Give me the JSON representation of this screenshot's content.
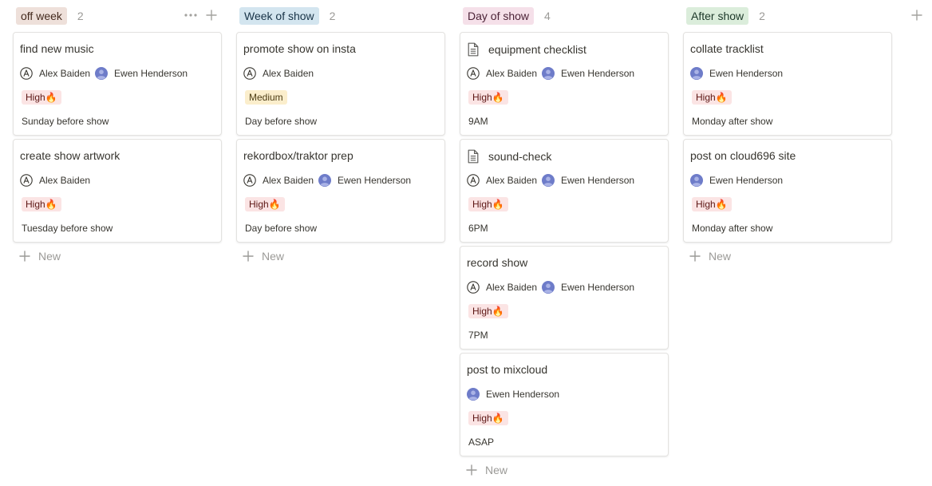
{
  "board": {
    "colors": {
      "text": "#37352f",
      "muted": "#9b9a97",
      "high_bg": "#fbe4e4",
      "medium_bg": "#fbeecc",
      "avatar": "#6e7cc9"
    },
    "new_label": "New",
    "columns": [
      {
        "title": "off week",
        "count": "2",
        "tag_bg": "#eee0da",
        "tag_color": "#442a1e",
        "cards": [
          {
            "title": "find new music",
            "has_doc_icon": false,
            "people": [
              "Alex Baiden",
              "Ewen Henderson"
            ],
            "priority": "High🔥",
            "priority_level": "high",
            "date": "Sunday before show"
          },
          {
            "title": "create show artwork",
            "has_doc_icon": false,
            "people": [
              "Alex Baiden"
            ],
            "priority": "High🔥",
            "priority_level": "high",
            "date": "Tuesday before show"
          }
        ]
      },
      {
        "title": "Week of show",
        "count": "2",
        "tag_bg": "#d3e5ef",
        "tag_color": "#183347",
        "cards": [
          {
            "title": "promote show on insta",
            "has_doc_icon": false,
            "people": [
              "Alex Baiden"
            ],
            "priority": "Medium",
            "priority_level": "medium",
            "date": "Day before show"
          },
          {
            "title": "rekordbox/traktor prep",
            "has_doc_icon": false,
            "people": [
              "Alex Baiden",
              "Ewen Henderson"
            ],
            "priority": "High🔥",
            "priority_level": "high",
            "date": "Day before show"
          }
        ]
      },
      {
        "title": "Day of show",
        "count": "4",
        "tag_bg": "#f5e0e9",
        "tag_color": "#4c2337",
        "cards": [
          {
            "title": "equipment checklist",
            "has_doc_icon": true,
            "people": [
              "Alex Baiden",
              "Ewen Henderson"
            ],
            "priority": "High🔥",
            "priority_level": "high",
            "date": "9AM"
          },
          {
            "title": "sound-check",
            "has_doc_icon": true,
            "people": [
              "Alex Baiden",
              "Ewen Henderson"
            ],
            "priority": "High🔥",
            "priority_level": "high",
            "date": "6PM"
          },
          {
            "title": "record show",
            "has_doc_icon": false,
            "people": [
              "Alex Baiden",
              "Ewen Henderson"
            ],
            "priority": "High🔥",
            "priority_level": "high",
            "date": "7PM"
          },
          {
            "title": "post to mixcloud",
            "has_doc_icon": false,
            "people": [
              "Ewen Henderson"
            ],
            "priority": "High🔥",
            "priority_level": "high",
            "date": "ASAP"
          }
        ]
      },
      {
        "title": "After show",
        "count": "2",
        "tag_bg": "#dbeddb",
        "tag_color": "#1c3829",
        "cards": [
          {
            "title": "collate tracklist",
            "has_doc_icon": false,
            "people": [
              "Ewen Henderson"
            ],
            "priority": "High🔥",
            "priority_level": "high",
            "date": "Monday after show"
          },
          {
            "title": "post on cloud696 site",
            "has_doc_icon": false,
            "people": [
              "Ewen Henderson"
            ],
            "priority": "High🔥",
            "priority_level": "high",
            "date": "Monday after show"
          }
        ]
      }
    ]
  }
}
